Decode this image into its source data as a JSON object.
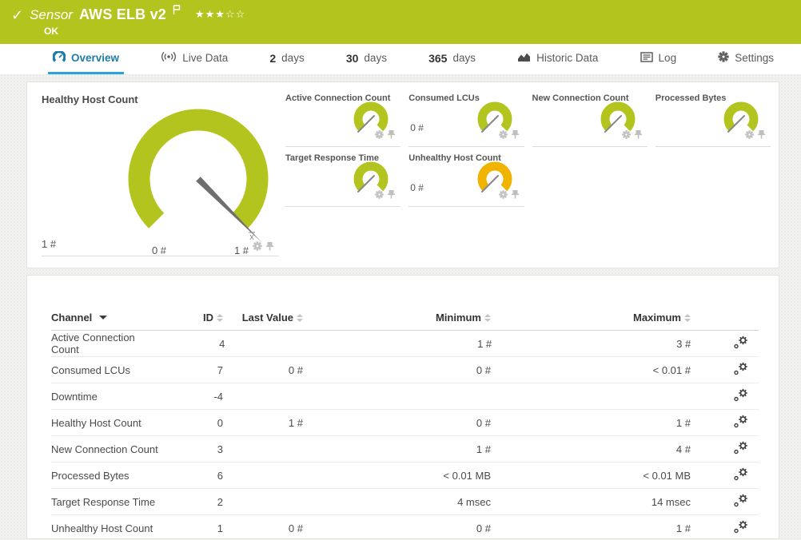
{
  "colors": {
    "ok_green": "#b3c41e",
    "warning_yellow": "#f0b400",
    "needle_gray": "#6f6f6f",
    "tab_active_blue": "#2aa3dd",
    "icon_gray": "#bfbfbd"
  },
  "header": {
    "status_check": "✓",
    "kind_label": "Sensor",
    "title": "AWS ELB v2",
    "status": "OK",
    "priority": {
      "filled": 3,
      "total": 5
    }
  },
  "tabs": {
    "items": [
      {
        "label": "Overview",
        "icon": "gauge-icon",
        "active": true
      },
      {
        "label": "Live Data",
        "icon": "live-icon",
        "active": false
      },
      {
        "num": "2",
        "label": "days",
        "active": false
      },
      {
        "num": "30",
        "label": "days",
        "active": false
      },
      {
        "num": "365",
        "label": "days",
        "active": false
      },
      {
        "label": "Historic Data",
        "icon": "area-chart-icon",
        "active": false
      },
      {
        "label": "Log",
        "icon": "log-icon",
        "active": false
      },
      {
        "label": "Settings",
        "icon": "gear-icon",
        "active": false
      }
    ]
  },
  "panel": {
    "big_gauge": {
      "title": "Healthy Host Count",
      "value": "1 #",
      "min_label": "0 #",
      "max_label": "1 #",
      "avg_marker": "x",
      "color": "#b3c41e",
      "needle_fraction": 1
    },
    "small_gauges": [
      {
        "title": "Active Connection Count",
        "value": "",
        "color": "#b3c41e",
        "needle_fraction": 0
      },
      {
        "title": "Consumed LCUs",
        "value": "0 #",
        "color": "#b3c41e",
        "needle_fraction": 0
      },
      {
        "title": "New Connection Count",
        "value": "",
        "color": "#b3c41e",
        "needle_fraction": 0
      },
      {
        "title": "Processed Bytes",
        "value": "",
        "color": "#b3c41e",
        "needle_fraction": 0
      },
      {
        "title": "Target Response Time",
        "value": "",
        "color": "#b3c41e",
        "needle_fraction": 0
      },
      {
        "title": "Unhealthy Host Count",
        "value": "0 #",
        "color": "#f0b400",
        "needle_fraction": 0
      }
    ]
  },
  "table": {
    "headers": {
      "channel": "Channel",
      "id": "ID",
      "last_value": "Last Value",
      "minimum": "Minimum",
      "maximum": "Maximum"
    },
    "rows": [
      {
        "channel": "Active Connection Count",
        "id": "4",
        "last": "",
        "min": "1 #",
        "max": "3 #"
      },
      {
        "channel": "Consumed LCUs",
        "id": "7",
        "last": "0 #",
        "min": "0 #",
        "max": "< 0.01 #"
      },
      {
        "channel": "Downtime",
        "id": "-4",
        "last": "",
        "min": "",
        "max": ""
      },
      {
        "channel": "Healthy Host Count",
        "id": "0",
        "last": "1 #",
        "min": "0 #",
        "max": "1 #"
      },
      {
        "channel": "New Connection Count",
        "id": "3",
        "last": "",
        "min": "1 #",
        "max": "4 #"
      },
      {
        "channel": "Processed Bytes",
        "id": "6",
        "last": "",
        "min": "< 0.01 MB",
        "max": "< 0.01 MB"
      },
      {
        "channel": "Target Response Time",
        "id": "2",
        "last": "",
        "min": "4 msec",
        "max": "14 msec"
      },
      {
        "channel": "Unhealthy Host Count",
        "id": "1",
        "last": "0 #",
        "min": "0 #",
        "max": "1 #"
      }
    ]
  }
}
